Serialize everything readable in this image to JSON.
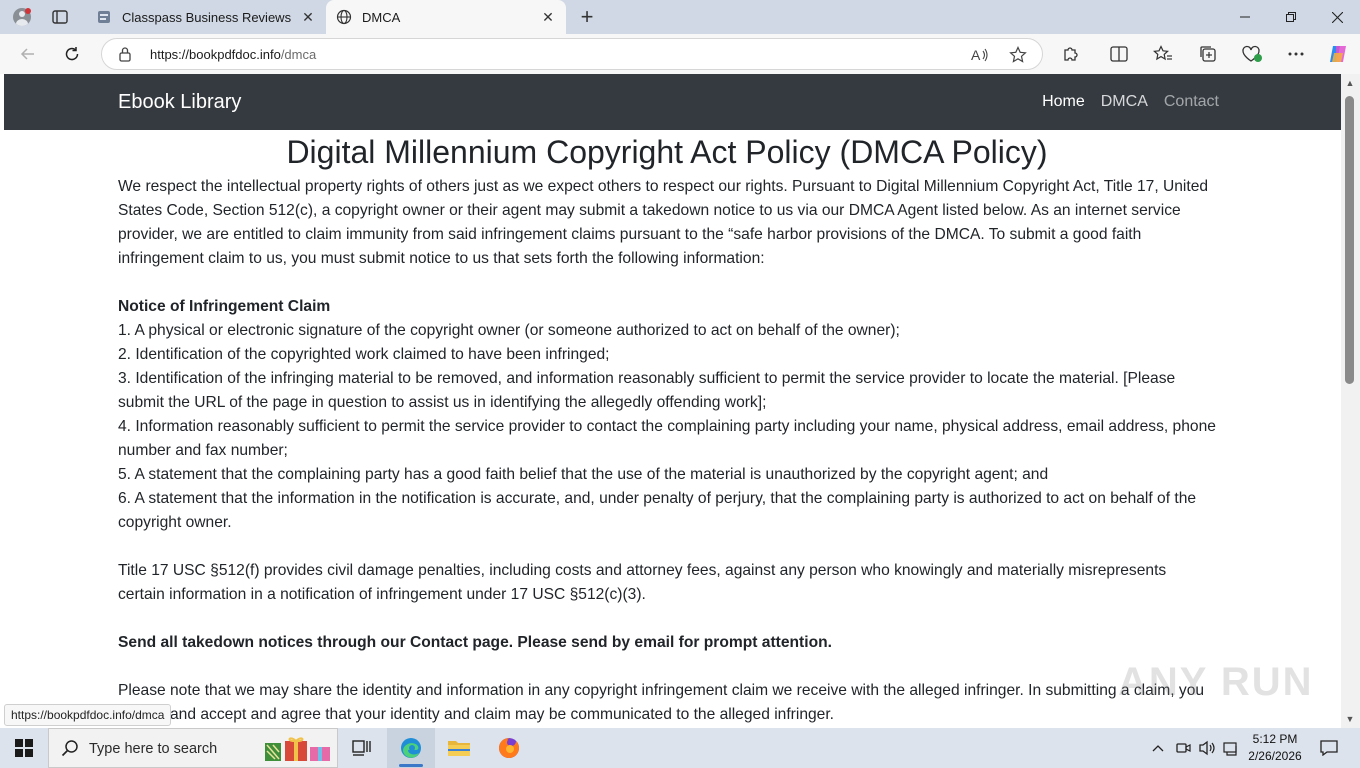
{
  "browser": {
    "tabs": [
      {
        "title": "Classpass Business Reviews",
        "active": false,
        "favicon": "page-favicon"
      },
      {
        "title": "DMCA",
        "active": true,
        "favicon": "globe-icon"
      }
    ],
    "url_domain": "https://bookpdfdoc.info",
    "url_path": "/dmca",
    "status_link": "https://bookpdfdoc.info/dmca"
  },
  "site": {
    "brand": "Ebook Library",
    "nav": [
      "Home",
      "DMCA",
      "Contact"
    ]
  },
  "page": {
    "title": "Digital Millennium Copyright Act Policy (DMCA Policy)",
    "intro": "We respect the intellectual property rights of others just as we expect others to respect our rights. Pursuant to Digital Millennium Copyright Act, Title 17, United States Code, Section 512(c), a copyright owner or their agent may submit a takedown notice to us via our DMCA Agent listed below. As an internet service provider, we are entitled to claim immunity from said infringement claims pursuant to the “safe harbor provisions of the DMCA. To submit a good faith infringement claim to us, you must submit notice to us that sets forth the following information:",
    "notice_heading": "Notice of Infringement Claim",
    "items": [
      "1. A physical or electronic signature of the copyright owner (or someone authorized to act on behalf of the owner);",
      "2. Identification of the copyrighted work claimed to have been infringed;",
      "3. Identification of the infringing material to be removed, and information reasonably sufficient to permit the service provider to locate the material. [Please submit the URL of the page in question to assist us in identifying the allegedly offending work];",
      "4. Information reasonably sufficient to permit the service provider to contact the complaining party including your name, physical address, email address, phone number and fax number;",
      "5. A statement that the complaining party has a good faith belief that the use of the material is unauthorized by the copyright agent; and",
      "6. A statement that the information in the notification is accurate, and, under penalty of perjury, that the complaining party is authorized to act on behalf of the copyright owner."
    ],
    "penalties": "Title 17 USC §512(f) provides civil damage penalties, including costs and attorney fees, against any person who knowingly and materially misrepresents certain information in a notification of infringement under 17 USC §512(c)(3).",
    "send_notice": "Send all takedown notices through our Contact page. Please send by email for prompt attention.",
    "share_note": "Please note that we may share the identity and information in any copyright infringement claim we receive with the alleged infringer. In submitting a claim, you understand accept and agree that your identity and claim may be communicated to the alleged infringer."
  },
  "watermark": "ANY RUN",
  "taskbar": {
    "search_placeholder": "Type here to search",
    "time": "5:12 PM",
    "date": "2/26/2026"
  },
  "colors": {
    "site_nav_bg": "#343a40",
    "tab_strip": "#cfd8e4",
    "taskbar": "#dde3ec"
  }
}
